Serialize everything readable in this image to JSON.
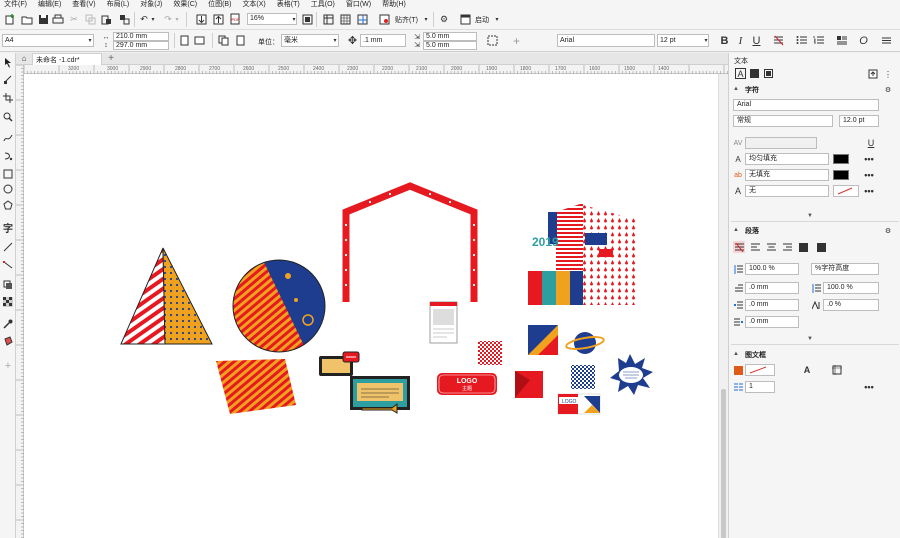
{
  "menu": [
    "文件(F)",
    "编辑(E)",
    "查看(V)",
    "布局(L)",
    "对象(J)",
    "效果(C)",
    "位图(B)",
    "文本(X)",
    "表格(T)",
    "工具(O)",
    "窗口(W)",
    "帮助(H)"
  ],
  "toolbar": {
    "zoom": "16%",
    "paste_label": "贴齐(T)",
    "launch_label": "启动"
  },
  "propbar": {
    "page_size": "A4",
    "width": "210.0 mm",
    "height": "297.0 mm",
    "unit_label": "单位：",
    "unit": "毫米",
    "nudge": ".1 mm",
    "dup_x": "5.0 mm",
    "dup_y": "5.0 mm",
    "font": "Arial",
    "font_size": "12 pt"
  },
  "tab": {
    "name": "未命名 -1.cdr*"
  },
  "ruler_labels": [
    "3200",
    "3000",
    "2900",
    "2800",
    "2700",
    "2600",
    "2500",
    "2400",
    "2300",
    "2200",
    "2100",
    "2000",
    "1900",
    "1800",
    "1700",
    "1600",
    "1500",
    "1400"
  ],
  "docker": {
    "title": "文本",
    "char_section": "字符",
    "font": "Arial",
    "style": "常规",
    "size": "12.0 pt",
    "fill1": "均匀填充",
    "fill2": "无填充",
    "outline": "无",
    "para_section": "段落",
    "line_spacing": "100.0 %",
    "spacing_mode": "%字符高度",
    "indent1": ".0 mm",
    "indent2": "100.0 %",
    "indent3": ".0 mm",
    "indent4": ".0 %",
    "indent5": ".0 mm",
    "frame_section": "图文框",
    "columns": "1"
  },
  "canvas": {
    "logo_btn_line1": "LOGO",
    "logo_btn_line2": "主题",
    "logo_small": "LOGO",
    "year": "2019"
  },
  "colors": {
    "red": "#e5191f",
    "navy": "#1f3d8f",
    "orange": "#f0a21e",
    "teal": "#2e9fa0"
  }
}
